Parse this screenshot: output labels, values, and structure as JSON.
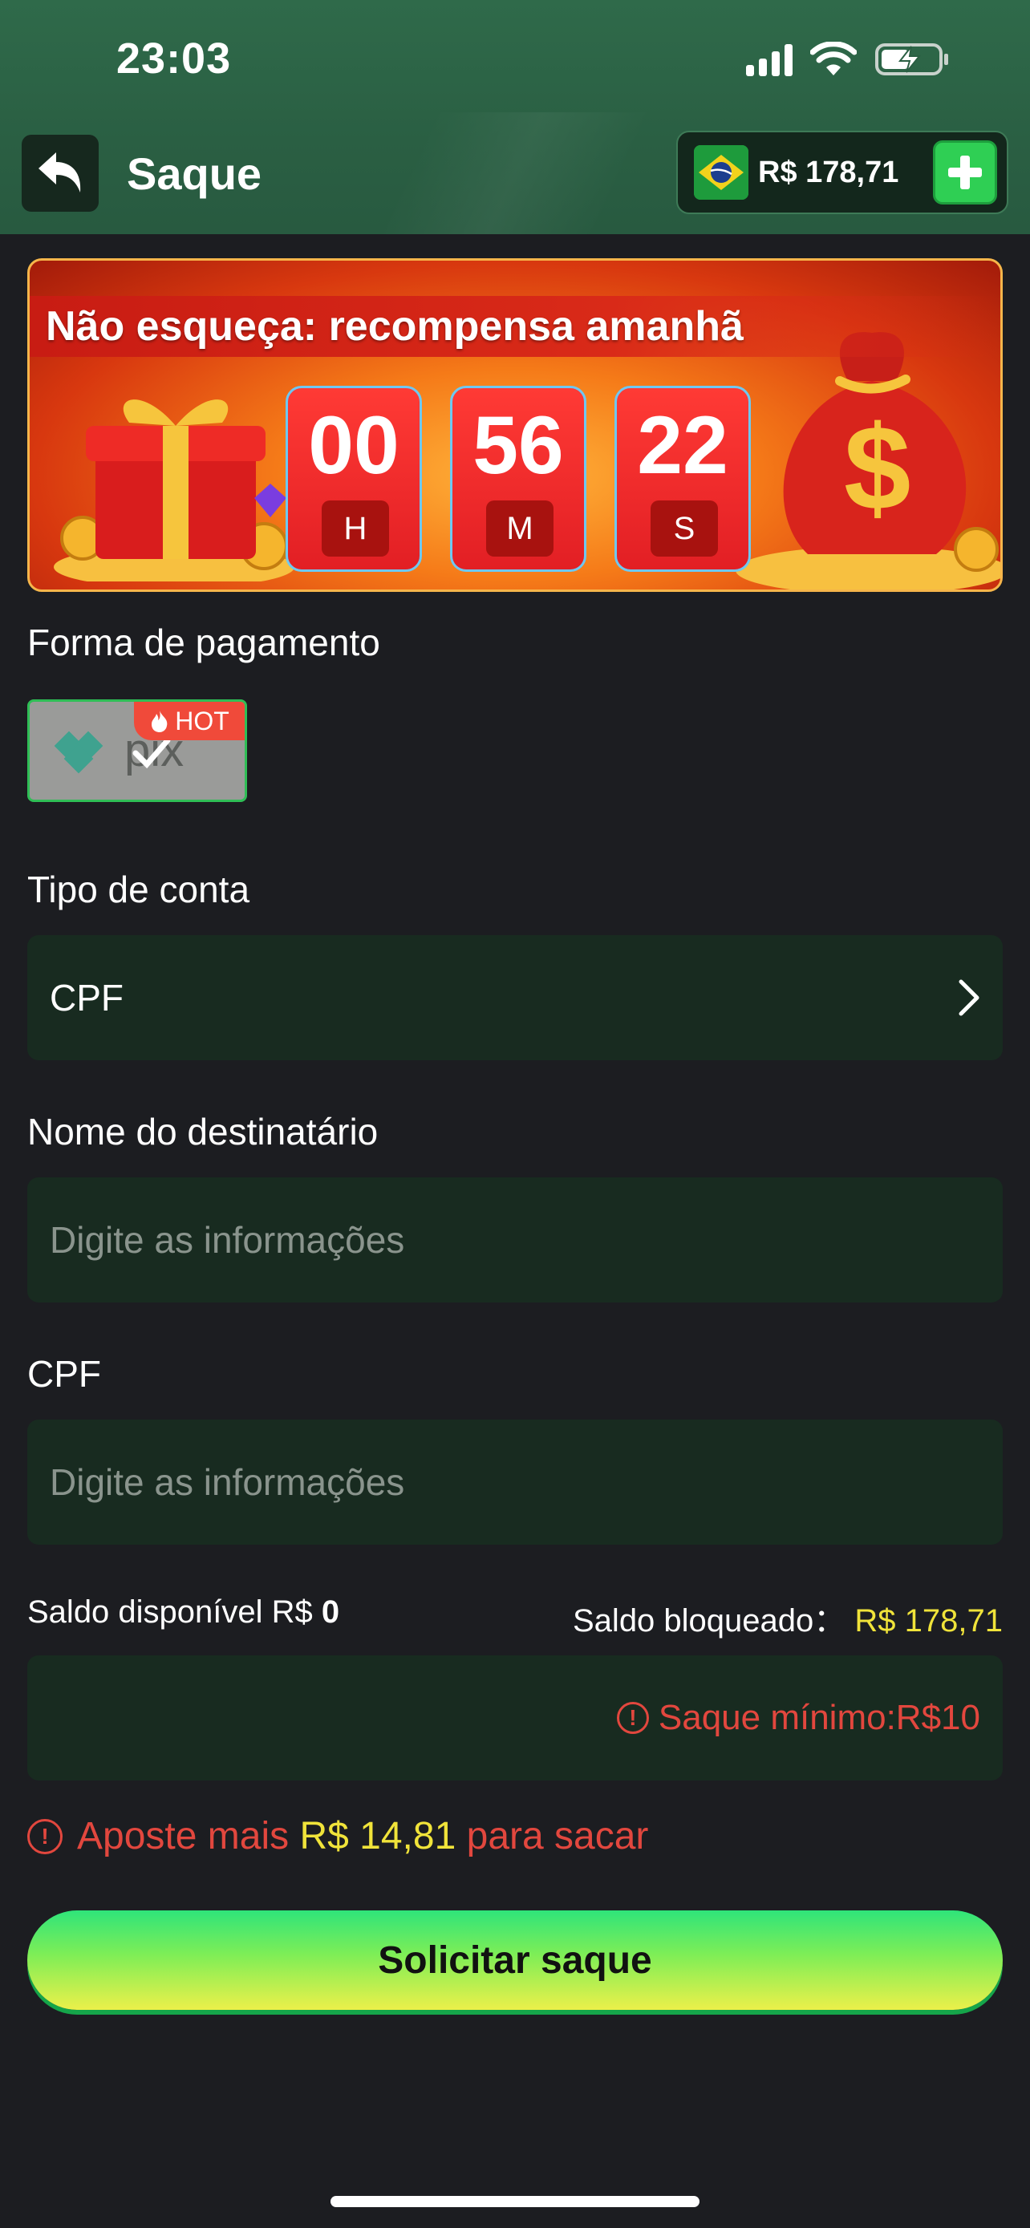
{
  "status_bar": {
    "time": "23:03"
  },
  "header": {
    "title": "Saque",
    "balance": "R$ 178,71"
  },
  "banner": {
    "title": "Não esqueça: recompensa amanhã",
    "timer": [
      {
        "value": "00",
        "unit": "H"
      },
      {
        "value": "56",
        "unit": "M"
      },
      {
        "value": "22",
        "unit": "S"
      }
    ]
  },
  "payment": {
    "label": "Forma de pagamento",
    "method": "pix",
    "badge": "HOT"
  },
  "account_type": {
    "label": "Tipo de conta",
    "value": "CPF"
  },
  "recipient": {
    "label": "Nome do destinatário",
    "placeholder": "Digite as informações"
  },
  "cpf": {
    "label": "CPF",
    "placeholder": "Digite as informações"
  },
  "balances": {
    "available_label": "Saldo disponível R$",
    "available_value": "0",
    "blocked_label": "Saldo bloqueado：",
    "blocked_value": "R$ 178,71"
  },
  "amount": {
    "min_note": "Saque mínimo:R$10"
  },
  "bet_note": {
    "prefix": "Aposte mais",
    "amount": "R$ 14,81",
    "suffix": "para sacar"
  },
  "submit": {
    "label": "Solicitar saque"
  },
  "colors": {
    "accent_green": "#2fcf54",
    "warning_red": "#e2473e",
    "highlight_yellow": "#f0e33a",
    "field_bg": "#182b20"
  }
}
